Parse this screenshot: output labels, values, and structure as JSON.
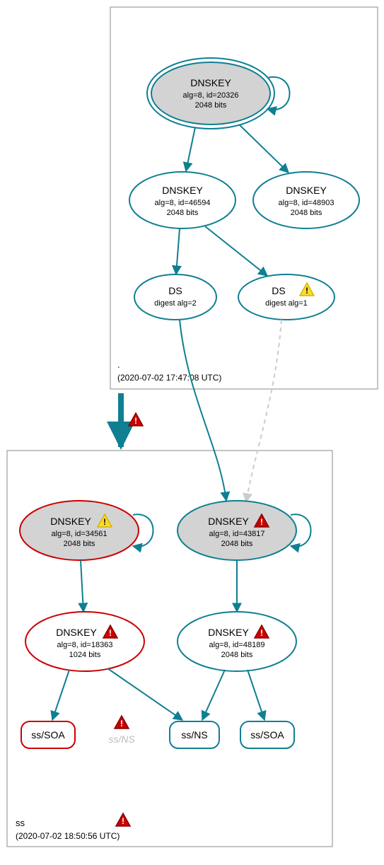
{
  "zones": {
    "root": {
      "label": ".",
      "timestamp": "(2020-07-02 17:47:08 UTC)"
    },
    "ss": {
      "label": "ss",
      "timestamp": "(2020-07-02 18:50:56 UTC)"
    }
  },
  "nodes": {
    "root_ksk": {
      "title": "DNSKEY",
      "line1": "alg=8, id=20326",
      "line2": "2048 bits"
    },
    "root_zsk1": {
      "title": "DNSKEY",
      "line1": "alg=8, id=46594",
      "line2": "2048 bits"
    },
    "root_zsk2": {
      "title": "DNSKEY",
      "line1": "alg=8, id=48903",
      "line2": "2048 bits"
    },
    "ds1": {
      "title": "DS",
      "line1": "digest alg=2"
    },
    "ds2": {
      "title": "DS",
      "line1": "digest alg=1"
    },
    "ss_ksk1": {
      "title": "DNSKEY",
      "line1": "alg=8, id=34561",
      "line2": "2048 bits"
    },
    "ss_ksk2": {
      "title": "DNSKEY",
      "line1": "alg=8, id=43817",
      "line2": "2048 bits"
    },
    "ss_zsk1": {
      "title": "DNSKEY",
      "line1": "alg=8, id=18363",
      "line2": "1024 bits"
    },
    "ss_zsk2": {
      "title": "DNSKEY",
      "line1": "alg=8, id=48189",
      "line2": "2048 bits"
    },
    "ss_soa1": {
      "title": "ss/SOA"
    },
    "ss_ns_ghost": {
      "title": "ss/NS"
    },
    "ss_ns": {
      "title": "ss/NS"
    },
    "ss_soa2": {
      "title": "ss/SOA"
    }
  }
}
